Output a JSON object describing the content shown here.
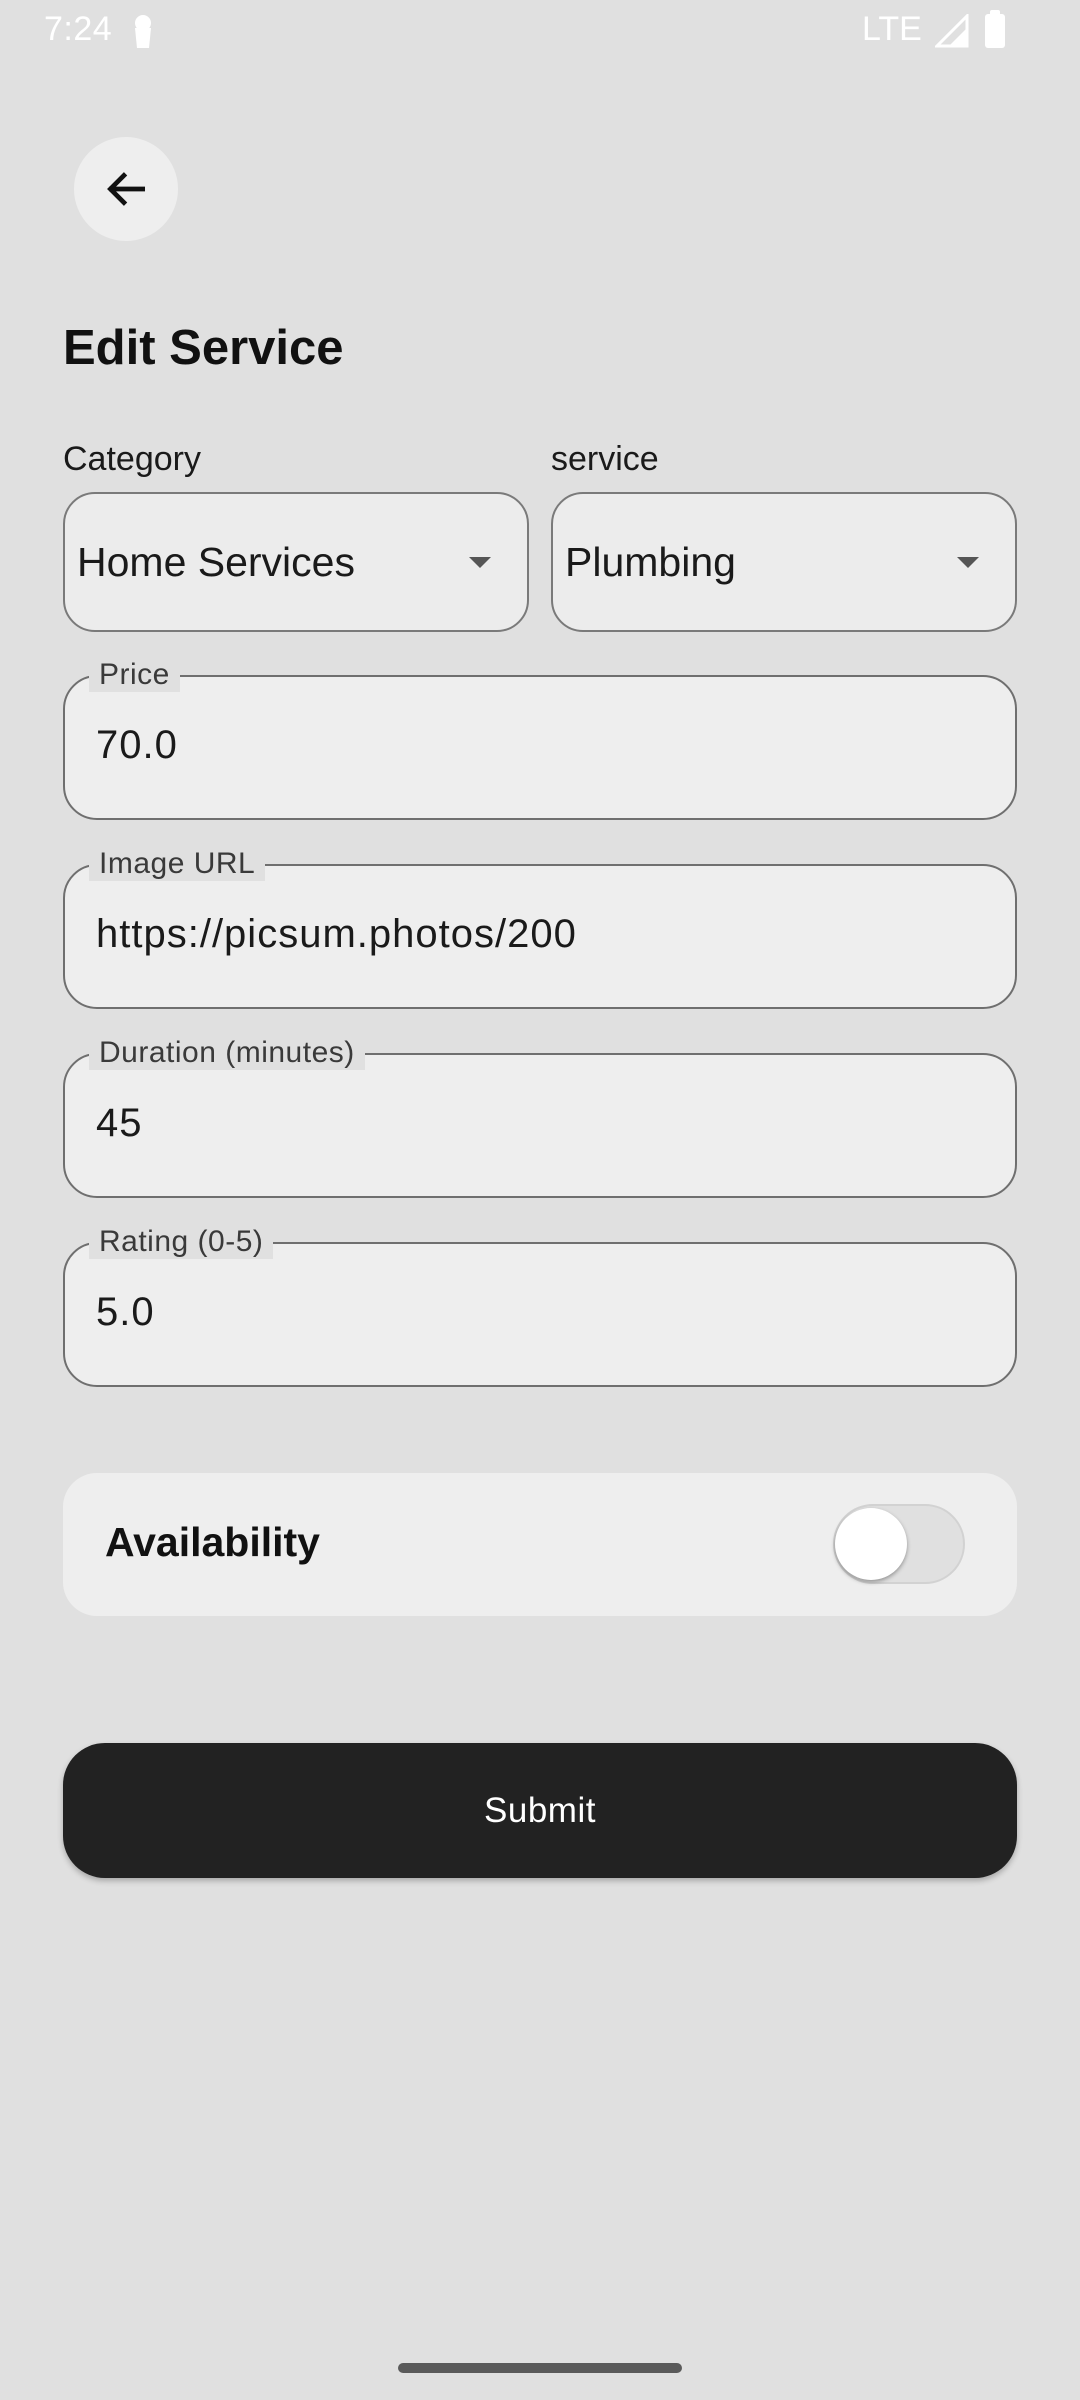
{
  "status_bar": {
    "time": "7:24",
    "network": "LTE",
    "icons": [
      "lock-icon",
      "signal-icon",
      "battery-icon"
    ]
  },
  "header": {
    "back_icon": "arrow-left-icon",
    "title": "Edit Service"
  },
  "form": {
    "category": {
      "label": "Category",
      "value": "Home Services"
    },
    "service": {
      "label": "service",
      "value": "Plumbing"
    },
    "price": {
      "label": "Price",
      "value": "70.0"
    },
    "image_url": {
      "label": "Image URL",
      "value": "https://picsum.photos/200"
    },
    "duration": {
      "label": "Duration (minutes)",
      "value": "45"
    },
    "rating": {
      "label": "Rating (0-5)",
      "value": "5.0"
    },
    "availability": {
      "label": "Availability",
      "enabled": false
    },
    "submit_label": "Submit"
  },
  "colors": {
    "background": "#e0e0e0",
    "field_fill": "#eeeeee",
    "primary_button": "#222222"
  }
}
